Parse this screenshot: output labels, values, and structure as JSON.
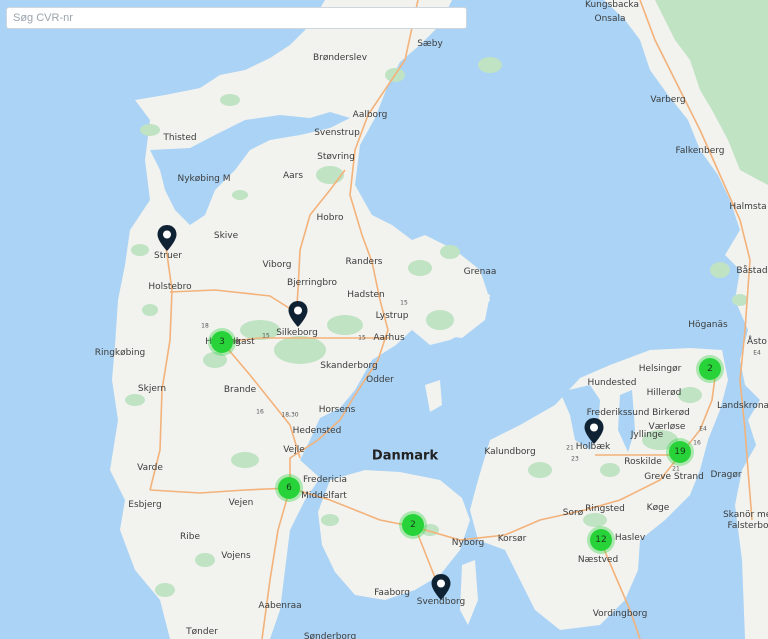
{
  "search": {
    "placeholder": "Søg CVR-nr",
    "value": ""
  },
  "map": {
    "colors": {
      "water": "#aad3f5",
      "land": "#f2f2ef",
      "forest": "#bfe3c3",
      "road": "#f3b27a",
      "cluster": "#28d33a",
      "pin": "#0f2234"
    },
    "labels": [
      {
        "text": "Kungsbacka"
      },
      {
        "text": "Onsala"
      },
      {
        "text": "Brønderslev"
      },
      {
        "text": "Sæby"
      },
      {
        "text": "Varberg"
      },
      {
        "text": "Aalborg"
      },
      {
        "text": "Thisted"
      },
      {
        "text": "Svenstrup"
      },
      {
        "text": "Falkenberg"
      },
      {
        "text": "Støvring"
      },
      {
        "text": "Nykøbing M"
      },
      {
        "text": "Aars"
      },
      {
        "text": "Halmsta"
      },
      {
        "text": "Hobro"
      },
      {
        "text": "Skive"
      },
      {
        "text": "Struer"
      },
      {
        "text": "Viborg"
      },
      {
        "text": "Randers"
      },
      {
        "text": "Grenaa"
      },
      {
        "text": "Båstad"
      },
      {
        "text": "Holstebro"
      },
      {
        "text": "Bjerringbro"
      },
      {
        "text": "Hadsten"
      },
      {
        "text": "Silkeborg"
      },
      {
        "text": "Lystrup"
      },
      {
        "text": "Höganäs"
      },
      {
        "text": "Herning"
      },
      {
        "text": "Ikast"
      },
      {
        "text": "Aarhus"
      },
      {
        "text": "Ringkøbing"
      },
      {
        "text": "Åsto"
      },
      {
        "text": "Skanderborg"
      },
      {
        "text": "Odder"
      },
      {
        "text": "Helsingør"
      },
      {
        "text": "Hundested"
      },
      {
        "text": "Skjern"
      },
      {
        "text": "Brande"
      },
      {
        "text": "Hillerød"
      },
      {
        "text": "Landskrona"
      },
      {
        "text": "Horsens"
      },
      {
        "text": "Frederikssund"
      },
      {
        "text": "Birkerød"
      },
      {
        "text": "Værløse"
      },
      {
        "text": "Hedensted"
      },
      {
        "text": "Jyllinge"
      },
      {
        "text": "Holbæk"
      },
      {
        "text": "Danmark"
      },
      {
        "text": "Vejle"
      },
      {
        "text": "Kalundborg"
      },
      {
        "text": "Roskilde"
      },
      {
        "text": "Varde"
      },
      {
        "text": "Fredericia"
      },
      {
        "text": "Greve Strand"
      },
      {
        "text": "Dragør"
      },
      {
        "text": "Esbjerg"
      },
      {
        "text": "Vejen"
      },
      {
        "text": "Middelfart"
      },
      {
        "text": "Køge"
      },
      {
        "text": "Sorø"
      },
      {
        "text": "Ringsted"
      },
      {
        "text": "Skanör med"
      },
      {
        "text": "Falsterbo"
      },
      {
        "text": "Ribe"
      },
      {
        "text": "Nyborg"
      },
      {
        "text": "Korsør"
      },
      {
        "text": "Haslev"
      },
      {
        "text": "Vojens"
      },
      {
        "text": "Næstved"
      },
      {
        "text": "Faaborg"
      },
      {
        "text": "Svendborg"
      },
      {
        "text": "Aabenraa"
      },
      {
        "text": "Vordingborg"
      },
      {
        "text": "Tønder"
      },
      {
        "text": "Sønderborg"
      }
    ],
    "road_numbers": [
      {
        "text": "15"
      },
      {
        "text": "18"
      },
      {
        "text": "15"
      },
      {
        "text": "15"
      },
      {
        "text": "18,30"
      },
      {
        "text": "16"
      },
      {
        "text": "21"
      },
      {
        "text": "23"
      },
      {
        "text": "16"
      },
      {
        "text": "E4"
      },
      {
        "text": "21"
      },
      {
        "text": "E4"
      }
    ],
    "clusters": [
      {
        "count": "3"
      },
      {
        "count": "2"
      },
      {
        "count": "19"
      },
      {
        "count": "6"
      },
      {
        "count": "2"
      },
      {
        "count": "12"
      }
    ],
    "pins": [
      {
        "name": "pin-struer"
      },
      {
        "name": "pin-silkeborg"
      },
      {
        "name": "pin-holbaek"
      },
      {
        "name": "pin-svendborg"
      }
    ]
  }
}
